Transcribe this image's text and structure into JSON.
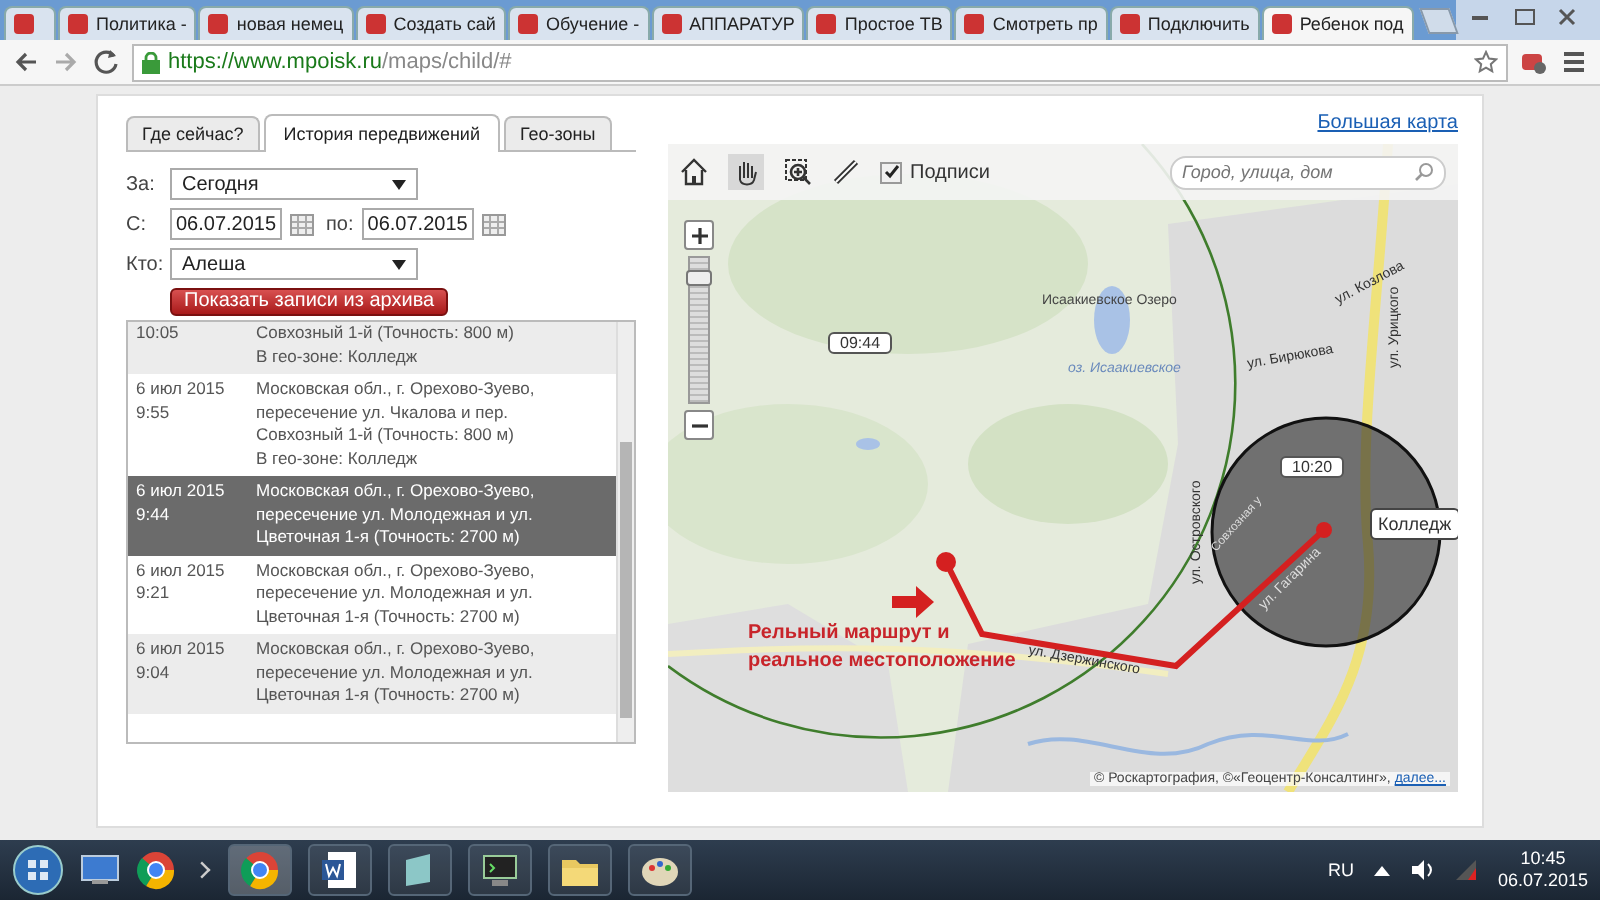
{
  "browser": {
    "tabs": [
      {
        "selected": false
      },
      {
        "title": "Политика -",
        "selected": false
      },
      {
        "title": "новая немец",
        "selected": false
      },
      {
        "title": "Создать сай",
        "selected": false
      },
      {
        "title": "Обучение -",
        "selected": false
      },
      {
        "title": "АППАРАТУР",
        "selected": false
      },
      {
        "title": "Простое ТВ",
        "selected": false
      },
      {
        "title": "Смотреть пр",
        "selected": false
      },
      {
        "title": "Подключить",
        "selected": false
      },
      {
        "title": "Ребенок под",
        "selected": true
      }
    ],
    "url": {
      "host": "https://www.mpoisk.ru",
      "path": "/maps/child/#"
    }
  },
  "panel_tabs": [
    {
      "label": "Где сейчас?",
      "selected": false
    },
    {
      "label": "История передвижений",
      "selected": true
    },
    {
      "label": "Гео-зоны",
      "selected": false
    }
  ],
  "filters": {
    "period": {
      "label": "За:",
      "value": "Сегодня"
    },
    "from": {
      "label": "С:",
      "value": "06.07.2015"
    },
    "to": {
      "label": "по:",
      "value": "06.07.2015"
    },
    "who": {
      "label": "Кто:",
      "value": "Алеша"
    },
    "button": "Показать записи из архива"
  },
  "history": [
    {
      "time": "10:05",
      "lines": [
        "Совхозный 1-й (Точность: 800 м)",
        "В гео-зоне: Колледж"
      ],
      "selected": false
    },
    {
      "date": "6 июл 2015",
      "time": "9:55",
      "lines": [
        "Московская обл., г. Орехово-Зуево,",
        "пересечение ул. Чкалова и пер.",
        "Совхозный 1-й (Точность: 800 м)",
        "В гео-зоне: Колледж"
      ],
      "selected": false
    },
    {
      "date": "6 июл 2015",
      "time": "9:44",
      "lines": [
        "Московская обл., г. Орехово-Зуево,",
        "пересечение ул. Молодежная и ул.",
        "Цветочная 1-я (Точность: 2700 м)"
      ],
      "selected": true
    },
    {
      "date": "6 июл 2015",
      "time": "9:21",
      "lines": [
        "Московская обл., г. Орехово-Зуево,",
        "пересечение ул. Молодежная и ул.",
        "Цветочная 1-я (Точность: 2700 м)"
      ],
      "selected": false
    },
    {
      "date": "6 июл 2015",
      "time": "9:04",
      "lines": [
        "Московская обл., г. Орехово-Зуево,",
        "пересечение ул. Молодежная и ул.",
        "Цветочная 1-я (Точность: 2700 м)"
      ],
      "selected": false
    }
  ],
  "big_map_link": "Большая карта",
  "map": {
    "labels_checkbox": {
      "label": "Подписи",
      "checked": true
    },
    "search_placeholder": "Город, улица, дом",
    "zoom": {
      "level": 0.9
    },
    "street_labels": [
      "Исаакиевское Озеро",
      "оз. Исаакиевское",
      "ул. Козлова",
      "ул. Бирюкова",
      "ул. Урицкого",
      "ул. Островского",
      "Совхозная у",
      "ул. Гагарина",
      "ул. Дзержинского"
    ],
    "time_markers": [
      "09:44",
      "10:20"
    ],
    "zone_label": "Колледж",
    "annotation": [
      "Рельный маршрут и",
      "реальное местоположение"
    ],
    "attribution": "© Роскартография, ©«Геоцентр-Консалтинг»,",
    "attribution_link": "далее..."
  },
  "taskbar": {
    "language": "RU",
    "time": "10:45",
    "date": "06.07.2015"
  }
}
